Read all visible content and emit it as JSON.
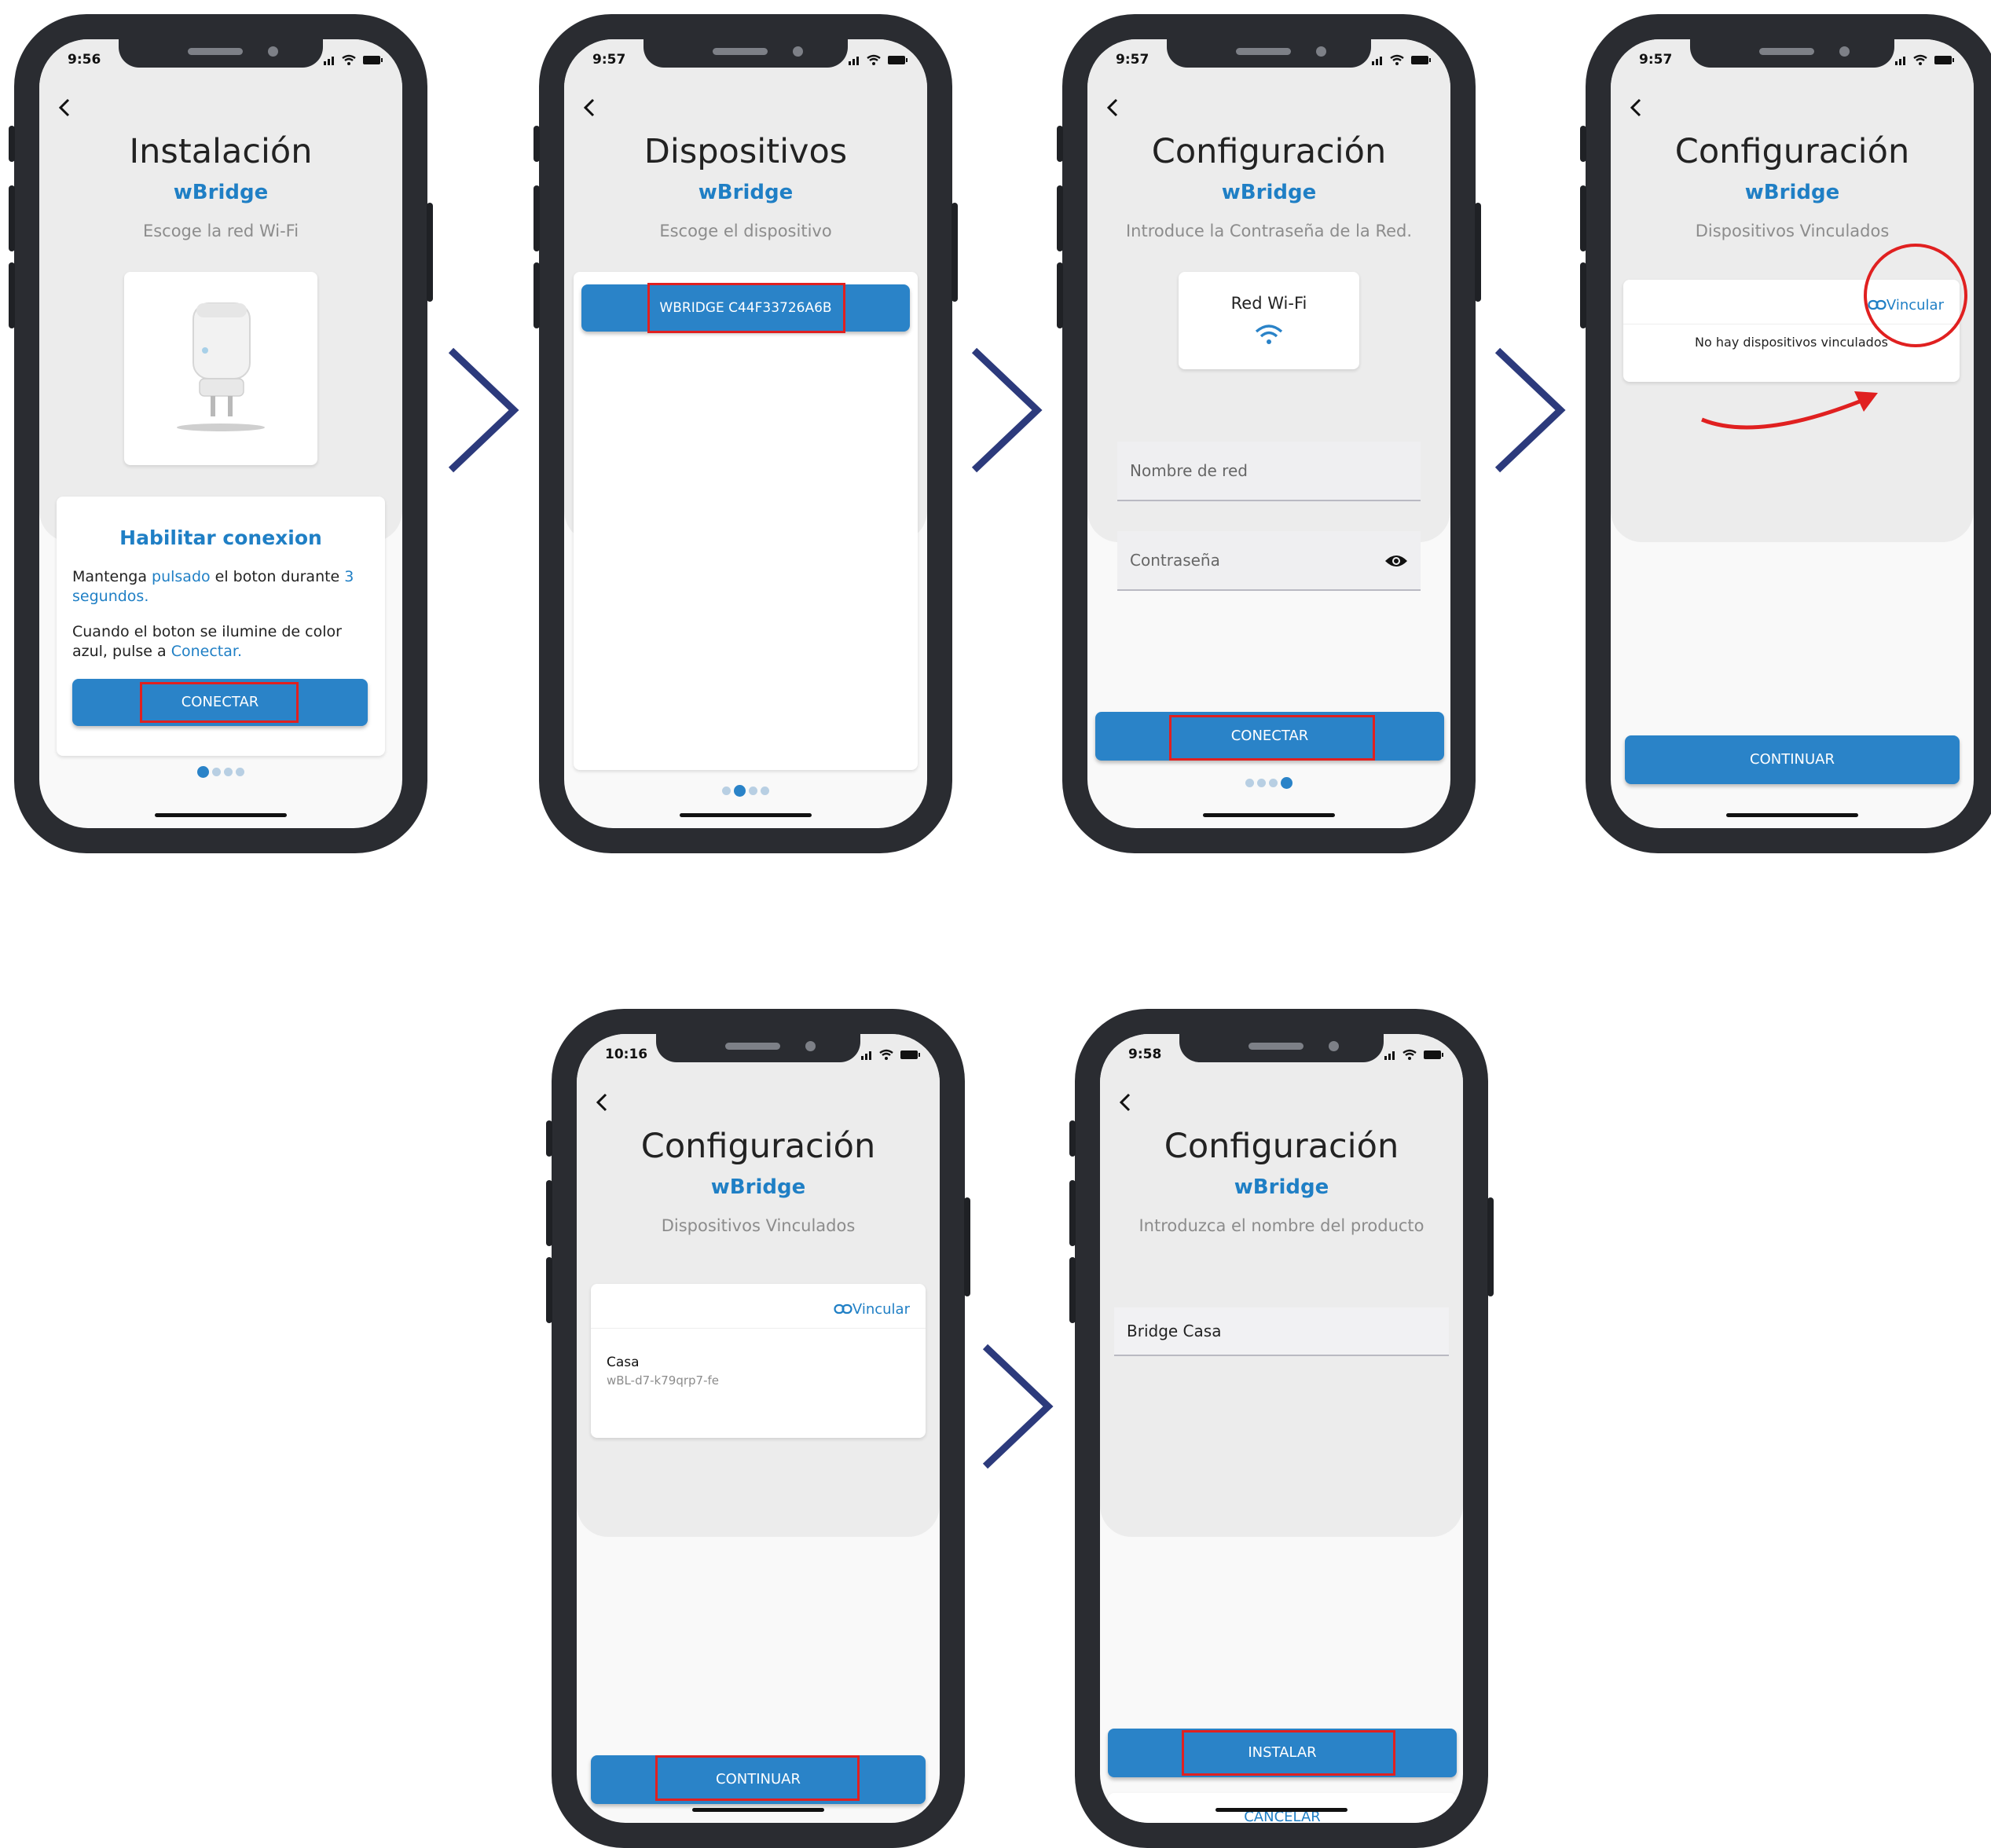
{
  "colors": {
    "accent": "#2a83c8",
    "brand": "#1f7fc5",
    "highlight": "#e02020",
    "arrow": "#2c3a7c",
    "frame": "#2a2c31"
  },
  "screens": [
    {
      "time": "9:56",
      "title": "Instalación",
      "brand": "wBridge",
      "subtitle": "Escoge la red Wi-Fi",
      "card": {
        "heading": "Habilitar conexion",
        "p1_a": "Mantenga ",
        "p1_b": "pulsado",
        "p1_c": " el boton durante ",
        "p1_d": "3 segundos.",
        "p2_a": "Cuando el boton se ilumine de color azul, pulse a ",
        "p2_b": "Conectar.",
        "button": "CONECTAR"
      },
      "pager_active": 0
    },
    {
      "time": "9:57",
      "title": "Dispositivos",
      "brand": "wBridge",
      "subtitle": "Escoge el dispositivo",
      "device_button": "WBRIDGE C44F33726A6B",
      "pager_active": 1
    },
    {
      "time": "9:57",
      "title": "Configuración",
      "brand": "wBridge",
      "subtitle": "Introduce la Contraseña de la Red.",
      "wifi_card": "Red Wi-Fi",
      "network_placeholder": "Nombre de red",
      "password_placeholder": "Contraseña",
      "button": "CONECTAR",
      "pager_active": 3
    },
    {
      "time": "9:57",
      "title": "Configuración",
      "brand": "wBridge",
      "subtitle": "Dispositivos Vinculados",
      "link": "Vincular",
      "empty": "No hay dispositivos vinculados",
      "button": "CONTINUAR"
    },
    {
      "time": "10:16",
      "title": "Configuración",
      "brand": "wBridge",
      "subtitle": "Dispositivos Vinculados",
      "link": "Vincular",
      "device_name": "Casa",
      "device_id": "wBL-d7-k79qrp7-fe",
      "button": "CONTINUAR"
    },
    {
      "time": "9:58",
      "title": "Configuración",
      "brand": "wBridge",
      "subtitle": "Introduzca el nombre del producto",
      "product_name": "Bridge Casa",
      "install_button": "INSTALAR",
      "cancel_button": "CANCELAR"
    }
  ]
}
